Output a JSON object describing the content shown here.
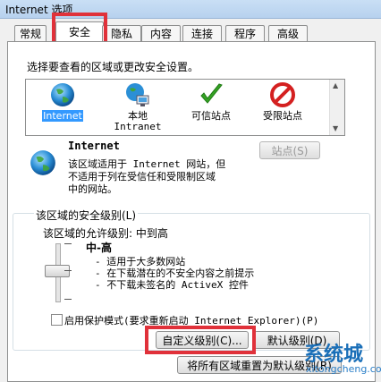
{
  "window": {
    "title": "Internet 选项"
  },
  "tabs": [
    {
      "label": "常规"
    },
    {
      "label": "安全"
    },
    {
      "label": "隐私"
    },
    {
      "label": "内容"
    },
    {
      "label": "连接"
    },
    {
      "label": "程序"
    },
    {
      "label": "高级"
    }
  ],
  "active_tab": "安全",
  "zone_prompt": "选择要查看的区域或更改安全设置。",
  "zones": [
    {
      "label": "Internet",
      "label2": "",
      "icon": "globe-icon",
      "selected": true
    },
    {
      "label": "本地",
      "label2": "Intranet",
      "icon": "network-computer-icon",
      "selected": false
    },
    {
      "label": "可信站点",
      "label2": "",
      "icon": "green-check-icon",
      "selected": false
    },
    {
      "label": "受限站点",
      "label2": "",
      "icon": "red-prohibited-icon",
      "selected": false
    }
  ],
  "zone_detail": {
    "title": "Internet",
    "desc_lines": [
      "该区域适用于 Internet 网站，但",
      "不适用于列在受信任和受限制区域",
      "中的网站。"
    ],
    "sites_button": "站点(S)"
  },
  "security_level": {
    "group_title": "该区域的安全级别(L)",
    "allowed": "该区域的允许级别: 中到高",
    "level_name": "中-高",
    "bullets": [
      "- 适用于大多数网站",
      "- 在下载潜在的不安全内容之前提示",
      "- 不下载未签名的 ActiveX 控件"
    ]
  },
  "protected_mode": {
    "label": "启用保护模式(要求重新启动 Internet Explorer)(P)",
    "checked": false
  },
  "buttons": {
    "custom_level": "自定义级别(C)...",
    "default_level": "默认级别(D)",
    "reset_all": "将所有区域重置为默认级别(R)"
  },
  "watermark": {
    "big": "系统城",
    "small": "xitongcheng.com"
  },
  "colors": {
    "highlight_red": "#e0313a",
    "selection_blue": "#3399ff"
  }
}
